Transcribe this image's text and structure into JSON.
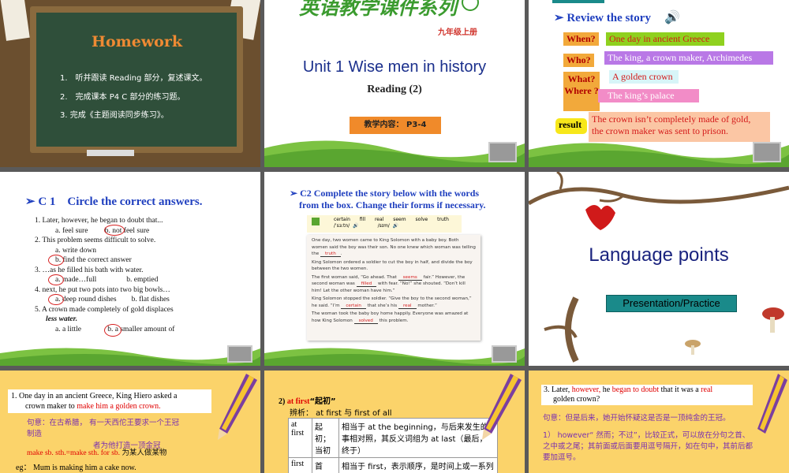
{
  "slide1": {
    "title": "Homework",
    "items": [
      "1.　听并跟读 Reading 部分，复述课文。",
      "2.　完成课本 P4 C 部分的练习题。",
      "3. 完成《主题阅读同步练习》。"
    ]
  },
  "slide2": {
    "series": "英语教学课件系列",
    "grade": "九年级上册",
    "unit": "Unit 1  Wise men in history",
    "reading": "Reading (2)",
    "content_label": "教学内容：  P3-4"
  },
  "slide3": {
    "heading": "Review the story",
    "when_label": "When?",
    "when_value": "One day in ancient Greece",
    "who_label": "Who?",
    "who_value": "The king, a crown maker, Archimedes",
    "what_label": "What?",
    "what_value": "A golden crown",
    "where_label": "Where ?",
    "where_value": "The king’s palace",
    "result_label": "result",
    "result_value_1": "The crown isn’t completely made of gold,",
    "result_value_2": "the crown maker was sent to prison."
  },
  "slide4": {
    "heading": "C 1　Circle the correct answers.",
    "q1": "1.   Later, however, he began to doubt that...",
    "q1_doubt": "doubt",
    "q1a": "a. feel sure",
    "q1b": "b. not feel sure",
    "q2": "2. This problem seems difficult to solve.",
    "q2a": "a. write down",
    "q2b": "b. find the correct answer",
    "q3": "3. …as he filled his bath with water.",
    "q3a": "a. made…full",
    "q3b": "b. emptied",
    "q4": "4. next, he put two pots into two big bowls…",
    "q4a": "a. deep round dishes",
    "q4b": "b. flat dishes",
    "q5": "5. A crown made completely of gold displaces",
    "q5_cont": "less water.",
    "q5a": "a. a little",
    "q5b": "b. a smaller amount of"
  },
  "slide5": {
    "heading_1": "C2  Complete the story below with the words",
    "heading_2": "from the box. Change their forms if necessary.",
    "words": [
      "certain",
      "fill",
      "real",
      "seem",
      "solve",
      "truth"
    ],
    "phon1": "/ˈsɜːtn/",
    "phon2": "/sɪm/",
    "p1": "One day, two women came to King Solomon with a baby boy. Both women said the boy was their son. No one knew which woman was telling the",
    "a1": "truth",
    "p2": "King Solomon ordered a soldier to cut the boy in half, and divide the boy between the two women.",
    "p3a": "The first woman said, “Go ahead. That",
    "a2": "seems",
    "p3b": "fair.” However, the second woman was",
    "a3": "filled",
    "p3c": "with fear. “No!” she shouted. “Don’t kill him! Let the other woman have him.”",
    "p4a": "King Solomon stopped the soldier. “Give the boy to the second woman,” he said. “I’m",
    "a4": "certain",
    "p4b": "that she’s his",
    "a5": "real",
    "p4c": "mother.”",
    "p5a": "The woman took the baby boy home happily. Everyone was amazed at how King Solomon",
    "a6": "solved",
    "p5b": "this problem."
  },
  "slide6": {
    "title": "Language points",
    "button": "Presentation/Practice"
  },
  "slide7": {
    "sentence_1": "1.   One day in an ancient Greece,  King Hiero asked a",
    "sentence_2": "crown maker to",
    "sentence_red": "make him a golden crown.",
    "meaning_1": "句意：在古希腊，    有一天西佗王要求一个王冠",
    "meaning_2": "制造",
    "overlap": "者为他打造一顶金冠",
    "phrase": "make sb. sth.=make sth. for sb.",
    "phrase_cn": "为某人做某物",
    "eg": "eg：   Mum is making him a cake now."
  },
  "slide8": {
    "point": "2)",
    "point_red": "at first",
    "point_cn": "“起初”",
    "compare": "辨析：  at first 与 first of all",
    "row1_term": "at first",
    "row1_mean": "起初；当初",
    "row1_desc": "相当于 at the beginning，与后来发生的事相对照，其反义词组为 at last（最后，终于）",
    "row2_term": "first",
    "row2_mean": "首先，",
    "row2_desc": "相当于 first，表示顺序，是时间上或一系列行动的开始，后面往往接 next，"
  },
  "slide9": {
    "sentence_a": "3. Later,",
    "sentence_however": "however,",
    "sentence_b": "he",
    "sentence_doubt": "began to doubt",
    "sentence_c": "that it was a",
    "sentence_real": "real",
    "sentence_d": "golden crown?",
    "meaning": "句意：但是后来，她开始怀疑这是否是一顶纯金的王冠。",
    "note": "1） however“ 然而；不过”，比较正式，可以放在分句之首、之中或之尾；其前面或后面要用逗号隔开，如在句中，其前后都要加逗号。"
  }
}
